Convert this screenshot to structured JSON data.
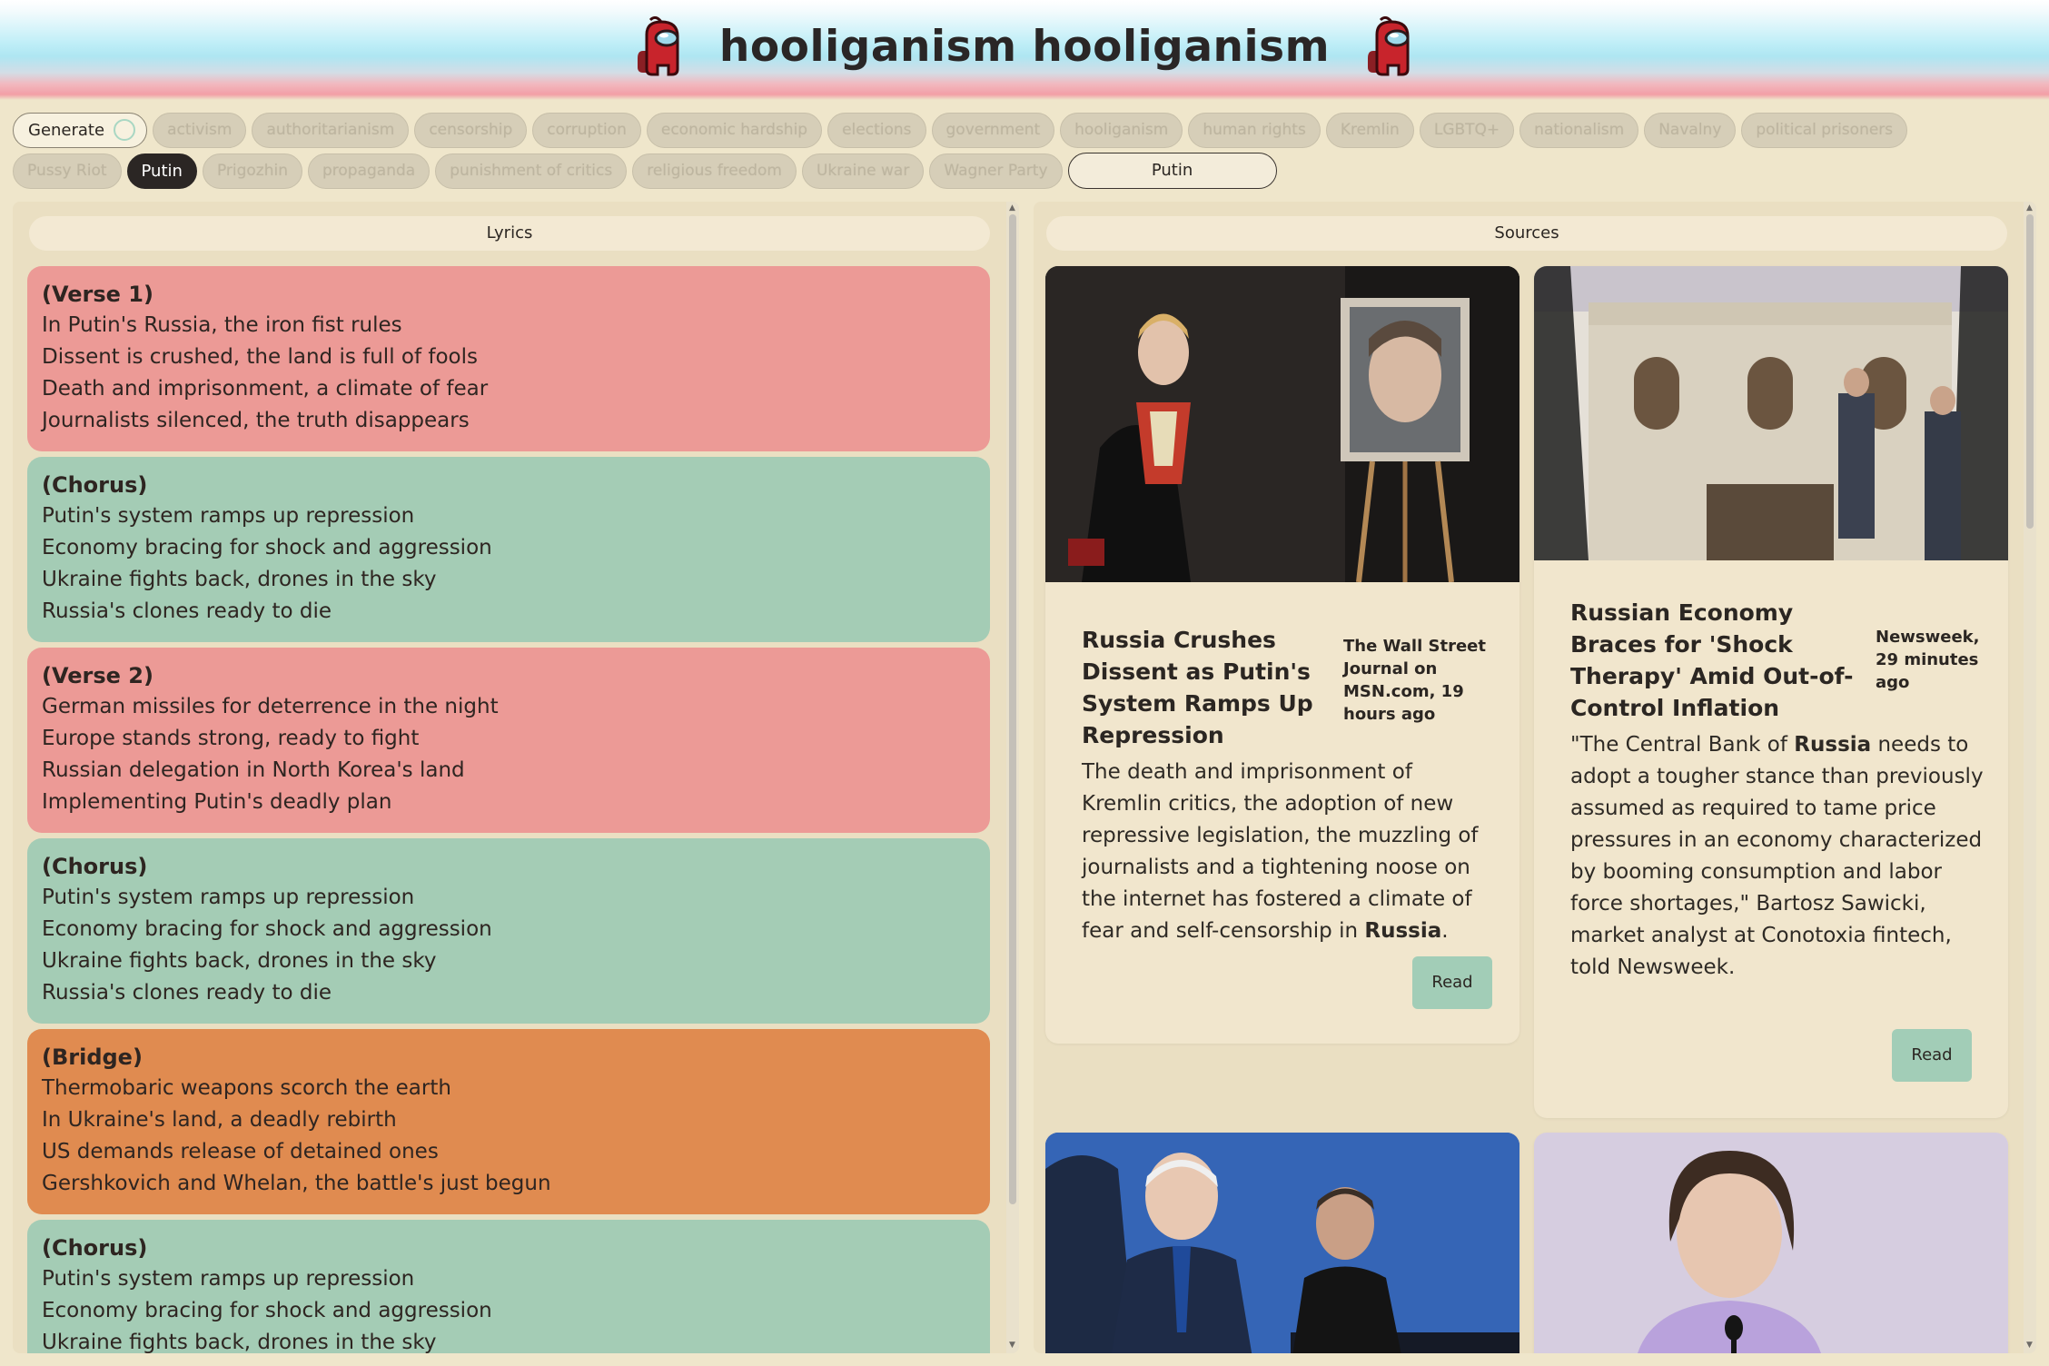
{
  "app": {
    "title": "hooliganism hooliganism"
  },
  "tags": {
    "generate_label": "Generate",
    "row1": [
      "activism",
      "authoritarianism",
      "censorship",
      "corruption",
      "economic hardship",
      "elections",
      "government",
      "hooliganism",
      "human rights",
      "Kremlin",
      "LGBTQ+",
      "nationalism",
      "Navalny",
      "political prisoners"
    ],
    "row2": [
      "Pussy Riot",
      "Putin",
      "Prigozhin",
      "propaganda",
      "punishment of critics",
      "religious freedom",
      "Ukraine war",
      "Wagner Party"
    ],
    "selected": "Putin",
    "topic_input_value": "Putin"
  },
  "lyrics": {
    "header": "Lyrics",
    "stanzas": [
      {
        "type": "verse",
        "title": "(Verse 1)",
        "lines": [
          "In Putin's Russia, the iron fist rules",
          "Dissent is crushed, the land is full of fools",
          "Death and imprisonment, a climate of fear",
          "Journalists silenced, the truth disappears"
        ]
      },
      {
        "type": "chorus",
        "title": "(Chorus)",
        "lines": [
          "Putin's system ramps up repression",
          "Economy bracing for shock and aggression",
          "Ukraine fights back, drones in the sky",
          "Russia's clones ready to die"
        ]
      },
      {
        "type": "verse",
        "title": "(Verse 2)",
        "lines": [
          "German missiles for deterrence in the night",
          "Europe stands strong, ready to fight",
          "Russian delegation in North Korea's land",
          "Implementing Putin's deadly plan"
        ]
      },
      {
        "type": "chorus",
        "title": "(Chorus)",
        "lines": [
          "Putin's system ramps up repression",
          "Economy bracing for shock and aggression",
          "Ukraine fights back, drones in the sky",
          "Russia's clones ready to die"
        ]
      },
      {
        "type": "bridge",
        "title": "(Bridge)",
        "lines": [
          "Thermobaric weapons scorch the earth",
          "In Ukraine's land, a deadly rebirth",
          "US demands release of detained ones",
          "Gershkovich and Whelan, the battle's just begun"
        ]
      },
      {
        "type": "chorus",
        "title": "(Chorus)",
        "lines": [
          "Putin's system ramps up repression",
          "Economy bracing for shock and aggression",
          "Ukraine fights back, drones in the sky"
        ]
      }
    ]
  },
  "sources": {
    "header": "Sources",
    "cards": [
      {
        "title": "Russia Crushes Dissent as Putin's System Ramps Up Repression",
        "meta": "The Wall Street Journal on MSN.com, 19 hours ago",
        "desc_before": "The death and imprisonment of Kremlin critics, the adoption of new repressive legislation, the muzzling of journalists and a tightening noose on the internet has fostered a climate of fear and self-censorship in ",
        "desc_bold": "Russia",
        "desc_after": ".",
        "read_label": "Read"
      },
      {
        "title": "Russian Economy Braces for 'Shock Therapy' Amid Out-of-Control Inflation",
        "meta": "Newsweek, 29 minutes ago",
        "desc_before": "\"The Central Bank of ",
        "desc_bold": "Russia",
        "desc_after": " needs to adopt a tougher stance than previously assumed as required to tame price pressures in an economy characterized by booming consumption and labor force shortages,\" Bartosz Sawicki, market analyst at Conotoxia fintech, told Newsweek.",
        "read_label": "Read"
      }
    ]
  },
  "colors": {
    "verse": "#ec9a96",
    "chorus": "#a4ccb5",
    "bridge": "#e08b50",
    "background": "#efe6cb",
    "read_button": "#a2cdb7"
  },
  "icons": {
    "mascot": "among-us-crewmate-icon"
  }
}
